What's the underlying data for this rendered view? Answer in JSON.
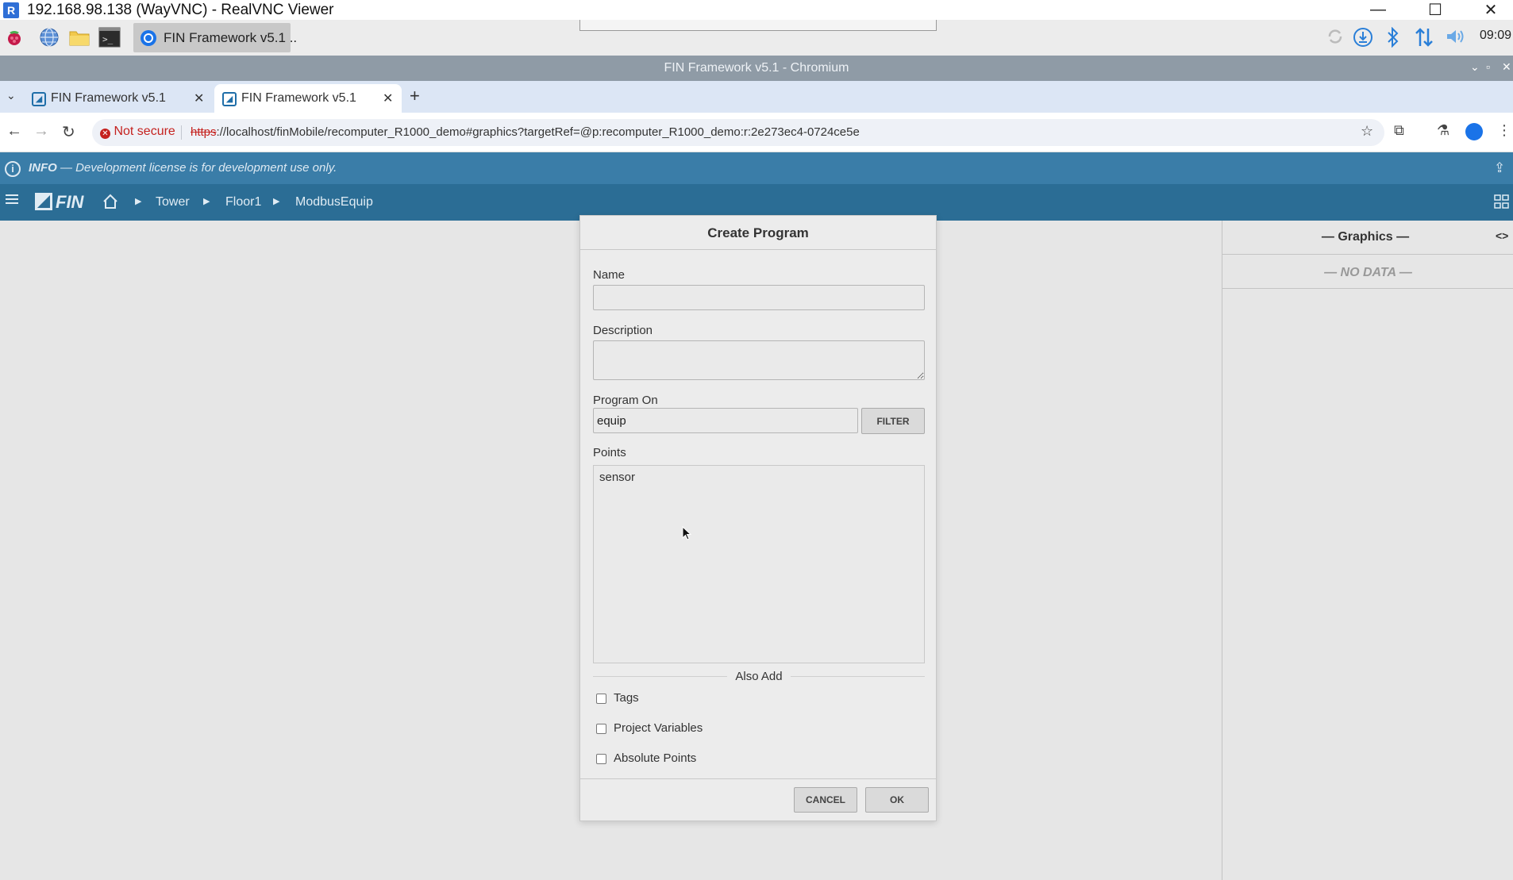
{
  "vnc": {
    "title": "192.168.98.138 (WayVNC) - RealVNC Viewer",
    "logo": "R",
    "minimize": "—",
    "maximize": "☐",
    "close": "✕"
  },
  "taskbar": {
    "active_task": "FIN Framework v5.1 ..",
    "clock": "09:09",
    "icons": [
      "raspberry-icon",
      "globe-icon",
      "folder-icon",
      "terminal-icon"
    ],
    "tray": [
      "sync-icon",
      "download-icon",
      "bluetooth-icon",
      "network-icon",
      "volume-icon"
    ]
  },
  "browser": {
    "window_title": "FIN Framework v5.1 - Chromium",
    "tabs": [
      {
        "label": "FIN Framework v5.1",
        "active": false
      },
      {
        "label": "FIN Framework v5.1",
        "active": true
      }
    ],
    "security": "Not secure",
    "url_scheme": "https",
    "url_rest": "://localhost/finMobile/recomputer_R1000_demo#graphics?targetRef=@p:recomputer_R1000_demo:r:2e273ec4-0724ce5e"
  },
  "infobar": {
    "label": "INFO",
    "message": "— Development license is for development use only."
  },
  "finnav": {
    "logo": "FIN",
    "breadcrumbs": [
      "Tower",
      "Floor1",
      "ModbusEquip"
    ]
  },
  "graphics_panel": {
    "title": "— Graphics —",
    "empty": "— NO DATA —"
  },
  "dialog": {
    "title": "Create Program",
    "name_label": "Name",
    "name_value": "",
    "description_label": "Description",
    "description_value": "",
    "program_on_label": "Program On",
    "program_on_value": "equip",
    "filter_button": "FILTER",
    "points_label": "Points",
    "points": [
      "sensor"
    ],
    "also_add_label": "Also Add",
    "checkboxes": [
      {
        "label": "Tags",
        "checked": false
      },
      {
        "label": "Project Variables",
        "checked": false
      },
      {
        "label": "Absolute Points",
        "checked": false
      }
    ],
    "cancel_button": "CANCEL",
    "ok_button": "OK"
  }
}
